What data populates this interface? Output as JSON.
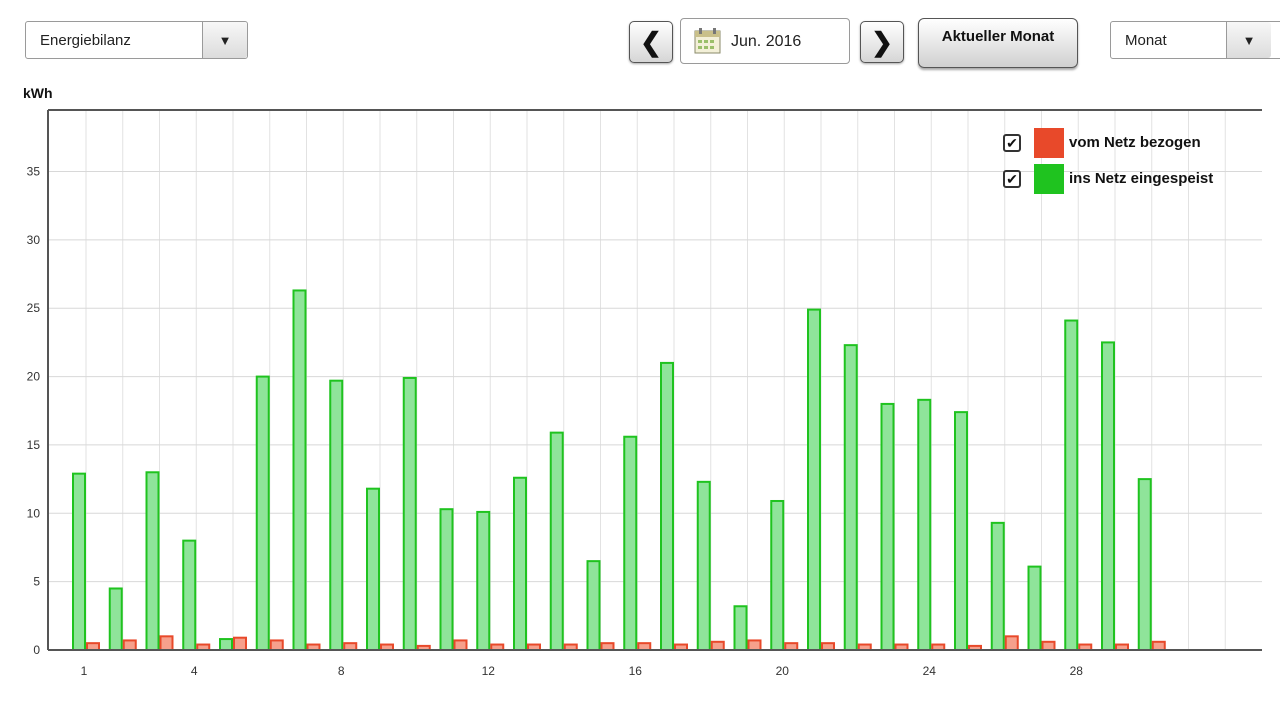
{
  "toolbar": {
    "view_select": "Energiebilanz",
    "date_value": "Jun. 2016",
    "current_button": "Aktueller Monat",
    "period_select": "Monat",
    "prev_arrow": "❮",
    "next_arrow": "❯",
    "dropdown_arrow": "▼"
  },
  "colors": {
    "grid_draw": "#e8492a",
    "grid_feed": "#1fc31f",
    "bar_feed_fill": "#8fe49a",
    "bar_draw_fill": "#f6a08c"
  },
  "chart_data": {
    "type": "bar",
    "ylabel": "kWh",
    "ylim": [
      0,
      39.5
    ],
    "yticks": [
      0,
      5,
      10,
      15,
      20,
      25,
      30,
      35
    ],
    "xtick_labels": [
      "1",
      "4",
      "8",
      "12",
      "16",
      "20",
      "24",
      "28"
    ],
    "xtick_days": [
      1,
      4,
      8,
      12,
      16,
      20,
      24,
      28
    ],
    "days_in_month": 32,
    "categories": [
      1,
      2,
      3,
      4,
      5,
      6,
      7,
      8,
      9,
      10,
      11,
      12,
      13,
      14,
      15,
      16,
      17,
      18,
      19,
      20,
      21,
      22,
      23,
      24,
      25,
      26,
      27,
      28,
      29,
      30
    ],
    "series": [
      {
        "name": "ins Netz eingespeist",
        "checked": true,
        "values": [
          12.9,
          4.5,
          13.0,
          8.0,
          0.8,
          20.0,
          26.3,
          19.7,
          11.8,
          19.9,
          10.3,
          10.1,
          12.6,
          15.9,
          6.5,
          15.6,
          21.0,
          12.3,
          3.2,
          10.9,
          24.9,
          22.3,
          18.0,
          18.3,
          17.4,
          9.3,
          6.1,
          24.1,
          22.5,
          12.5
        ]
      },
      {
        "name": "vom Netz bezogen",
        "checked": true,
        "values": [
          0.5,
          0.7,
          1.0,
          0.4,
          0.9,
          0.7,
          0.4,
          0.5,
          0.4,
          0.3,
          0.7,
          0.4,
          0.4,
          0.4,
          0.5,
          0.5,
          0.4,
          0.6,
          0.7,
          0.5,
          0.5,
          0.4,
          0.4,
          0.4,
          0.3,
          1.0,
          0.6,
          0.4,
          0.4,
          0.6
        ]
      }
    ],
    "legend": [
      {
        "label": "vom Netz bezogen",
        "color": "#e8492a",
        "checked": true
      },
      {
        "label": "ins Netz eingespeist",
        "color": "#1fc31f",
        "checked": true
      }
    ],
    "legend_position": "top-right",
    "grid": true
  }
}
